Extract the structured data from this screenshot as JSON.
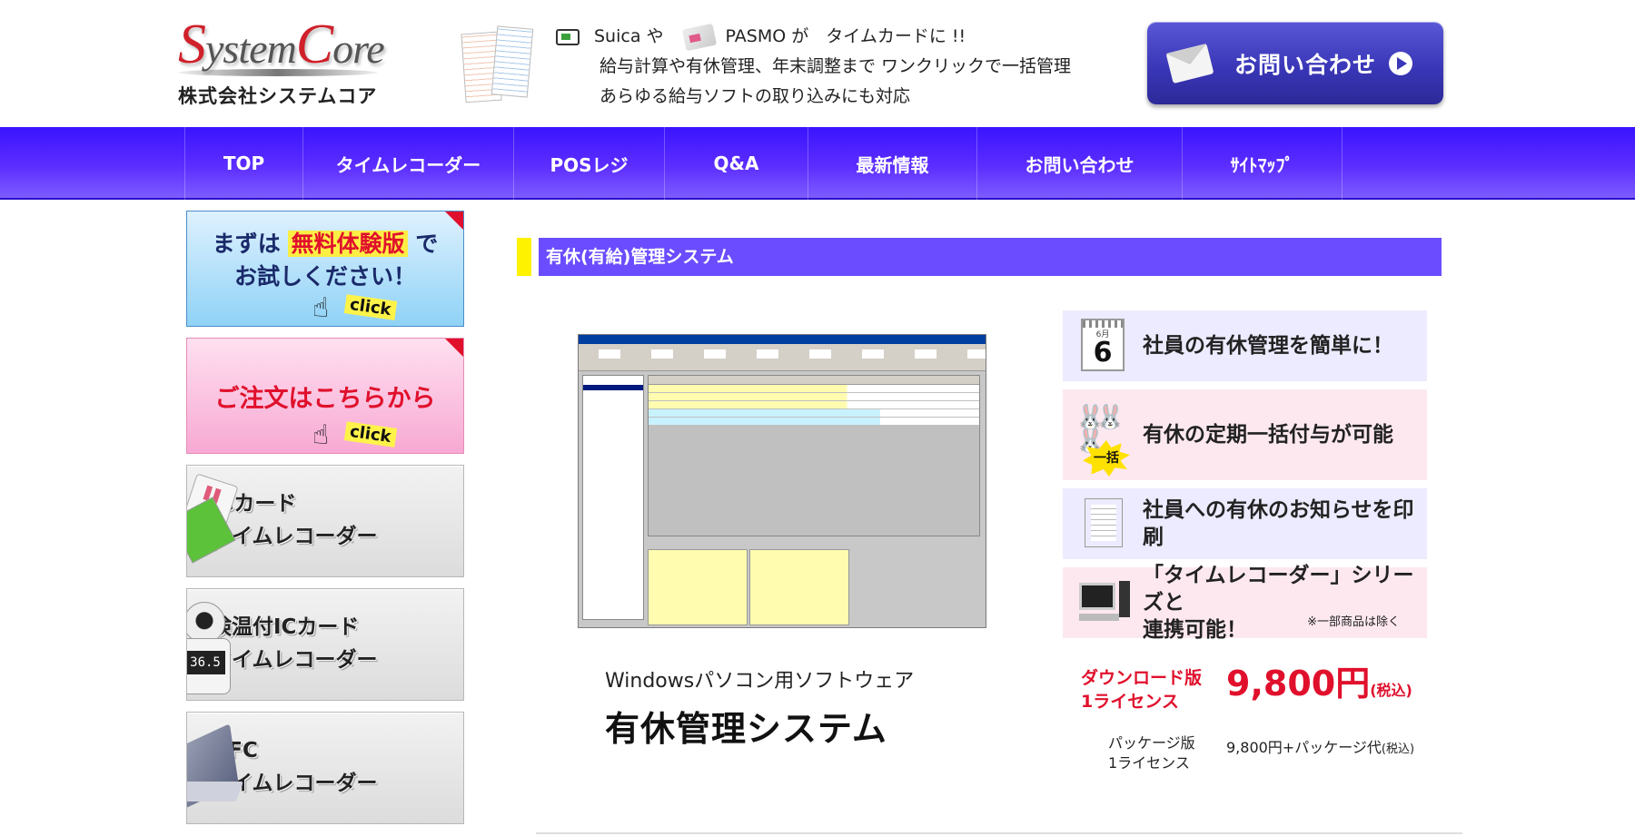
{
  "header": {
    "logo": {
      "first_initial": "S",
      "first_rest": "ystem",
      "second_initial": "C",
      "second_rest": "ore",
      "company": "株式会社システムコア"
    },
    "tagline": {
      "line1_a": "Suica や",
      "line1_b": "PASMO が　タイムカードに !!",
      "line2": "給与計算や有休管理、年末調整まで ワンクリックで一括管理",
      "line3": "あらゆる給与ソフトの取り込みにも対応"
    },
    "contact_button": "お問い合わせ"
  },
  "nav": {
    "items": [
      {
        "label": "TOP",
        "width": 150
      },
      {
        "label": "タイムレコーダー",
        "width": 266
      },
      {
        "label": "POSレジ",
        "width": 190
      },
      {
        "label": "Q&A",
        "width": 158
      },
      {
        "label": "最新情報",
        "width": 186
      },
      {
        "label": "お問い合わせ",
        "width": 226
      },
      {
        "label": "ｻｲﾄﾏｯﾌﾟ",
        "width": 176
      }
    ]
  },
  "sidebar": {
    "trial": {
      "prefix": "まずは",
      "highlight": "無料体験版",
      "suffix": "で",
      "line2": "お試しください！",
      "click": "click"
    },
    "order": {
      "label": "ご注文はこちらから",
      "click": "click"
    },
    "products": [
      {
        "line1": "ICカード",
        "line2": "タイムレコーダー",
        "art": "ic-cards-icon"
      },
      {
        "line1": "検温付ICカード",
        "line2": "タイムレコーダー",
        "art": "thermometer-icon",
        "reading": "36.5"
      },
      {
        "line1": "NFC",
        "line2": "タイムレコーダー",
        "art": "nfc-reader-icon"
      }
    ]
  },
  "main": {
    "section_title": "有休(有給)管理システム",
    "caption": {
      "sub": "Windowsパソコン用ソフトウェア",
      "main": "有休管理システム"
    },
    "features": [
      {
        "text": "社員の有休管理を簡単に！",
        "icon": "calendar-icon",
        "calendar_month": "6月",
        "calendar_day": "6"
      },
      {
        "text": "有休の定期一括付与が可能",
        "icon": "rabbits-icon",
        "badge": "一括"
      },
      {
        "text": "社員への有休のお知らせを印刷",
        "icon": "document-icon"
      },
      {
        "text_line1": "「タイムレコーダー」シリーズと",
        "text_line2": "連携可能！",
        "note": "※一部商品は除く",
        "icon": "computer-icon"
      }
    ],
    "pricing": {
      "download_label_1": "ダウンロード版",
      "download_label_2": "1ライセンス",
      "download_price": "9,800円",
      "download_tax": "(税込)",
      "package_label_1": "パッケージ版",
      "package_label_2": "1ライセンス",
      "package_price": "9,800円+パッケージ代",
      "package_tax": "(税込)"
    }
  },
  "colors": {
    "nav": "#4a1fff",
    "title_bar": "#6b4dff",
    "marker": "#fff200",
    "price_red": "#e0102c"
  }
}
